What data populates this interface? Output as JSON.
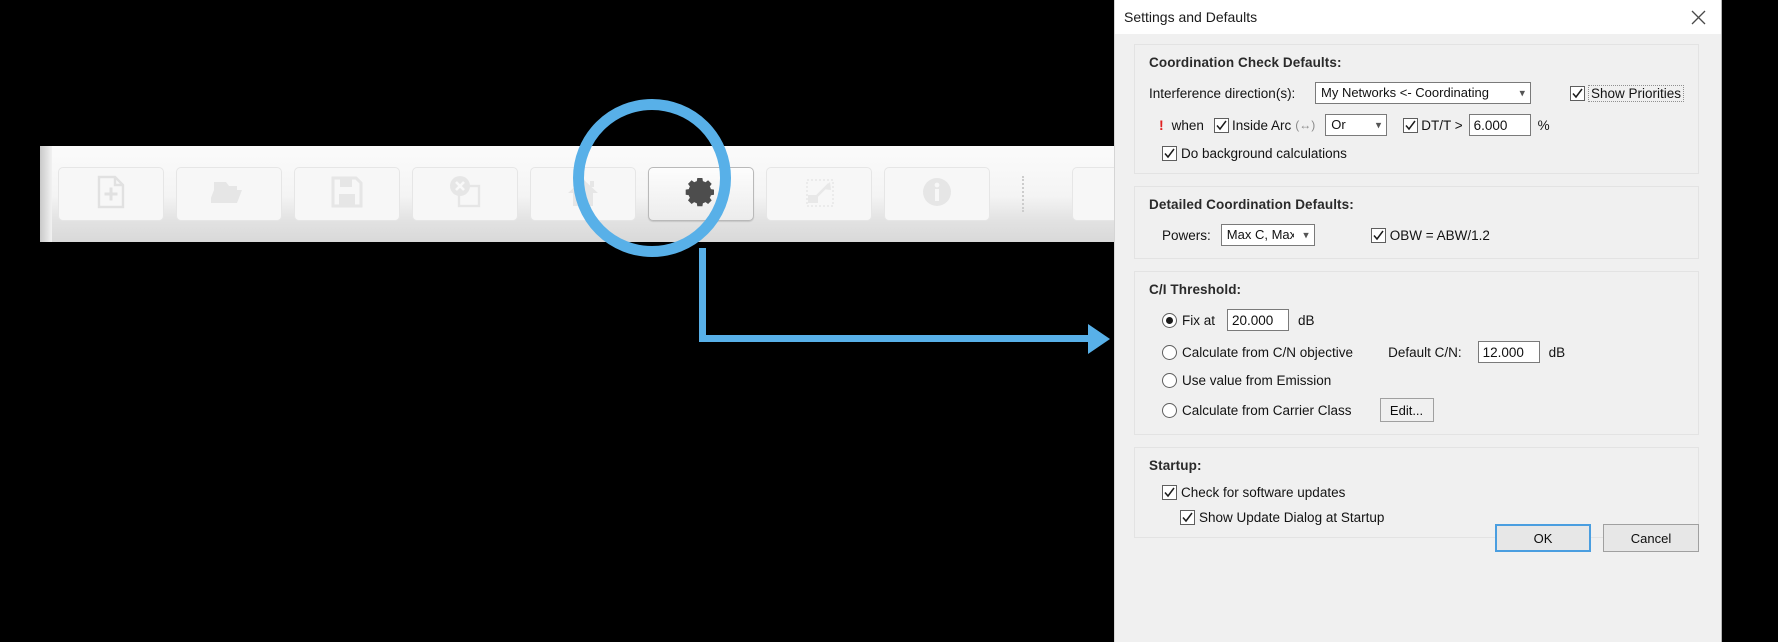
{
  "toolbar": {
    "buttons": [
      {
        "name": "new-document-icon",
        "label": "New",
        "active": false
      },
      {
        "name": "open-folder-icon",
        "label": "Open",
        "active": false
      },
      {
        "name": "save-icon",
        "label": "Save",
        "active": false
      },
      {
        "name": "close-document-icon",
        "label": "Close",
        "active": false
      },
      {
        "name": "home-icon",
        "label": "Home",
        "active": false
      },
      {
        "name": "gear-icon",
        "label": "Settings",
        "active": true
      },
      {
        "name": "export-chart-icon",
        "label": "Export",
        "active": false
      },
      {
        "name": "info-icon",
        "label": "Info",
        "active": false
      }
    ]
  },
  "annotation": {
    "accent_color": "#58b0e8",
    "highlighted_button": "gear-icon"
  },
  "dialog": {
    "title": "Settings and Defaults",
    "close_icon": "close-icon",
    "groups": {
      "coordination": {
        "title": "Coordination Check Defaults:",
        "direction_label": "Interference direction(s):",
        "direction_value": "My Networks <- Coordinating",
        "show_priorities_label": "Show Priorities",
        "show_priorities_checked": true,
        "bang": "!",
        "when_label": "when",
        "inside_arc_label": "Inside Arc",
        "inside_arc_hint": "(↔)",
        "inside_arc_checked": true,
        "operator_value": "Or",
        "dtt_checked": true,
        "dtt_label": "DT/T >",
        "dtt_value": "6.000",
        "dtt_unit": "%",
        "background_calc_label": "Do background calculations",
        "background_calc_checked": true
      },
      "detailed": {
        "title": "Detailed Coordination Defaults:",
        "powers_label": "Powers:",
        "powers_value": "Max C, Max I",
        "obw_label": "OBW = ABW/1.2",
        "obw_checked": true
      },
      "ci": {
        "title": "C/I Threshold:",
        "fix_at_label": "Fix at",
        "fix_at_value": "20.000",
        "fix_at_unit": "dB",
        "fix_at_selected": true,
        "calc_cn_label": "Calculate from C/N objective",
        "calc_cn_selected": false,
        "default_cn_label": "Default C/N:",
        "default_cn_value": "12.000",
        "default_cn_unit": "dB",
        "use_emission_label": "Use value from Emission",
        "use_emission_selected": false,
        "carrier_class_label": "Calculate from Carrier Class",
        "carrier_class_selected": false,
        "edit_button_label": "Edit..."
      },
      "startup": {
        "title": "Startup:",
        "check_updates_label": "Check for software updates",
        "check_updates_checked": true,
        "show_update_dialog_label": "Show Update Dialog at Startup",
        "show_update_dialog_checked": true
      }
    },
    "footer": {
      "ok_label": "OK",
      "cancel_label": "Cancel"
    }
  }
}
